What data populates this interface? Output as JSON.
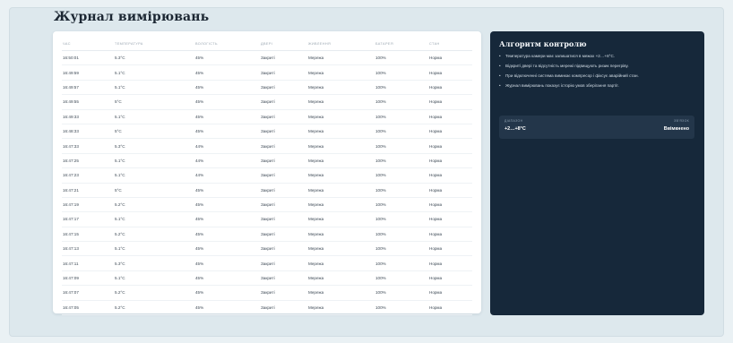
{
  "page": {
    "title": "Журнал вимірювань"
  },
  "table": {
    "columns": [
      "Час",
      "Температура",
      "Вологість",
      "Двері",
      "Живлення",
      "Батарея",
      "Стан"
    ],
    "rows": [
      [
        "16:50:01",
        "5.3°C",
        "45%",
        "Закриті",
        "Мережа",
        "100%",
        "Норма"
      ],
      [
        "16:49:59",
        "5.1°C",
        "45%",
        "Закриті",
        "Мережа",
        "100%",
        "Норма"
      ],
      [
        "16:49:57",
        "5.1°C",
        "45%",
        "Закриті",
        "Мережа",
        "100%",
        "Норма"
      ],
      [
        "16:49:55",
        "5°C",
        "45%",
        "Закриті",
        "Мережа",
        "100%",
        "Норма"
      ],
      [
        "16:49:33",
        "5.1°C",
        "45%",
        "Закриті",
        "Мережа",
        "100%",
        "Норма"
      ],
      [
        "16:48:33",
        "5°C",
        "45%",
        "Закриті",
        "Мережа",
        "100%",
        "Норма"
      ],
      [
        "16:47:33",
        "5.3°C",
        "44%",
        "Закриті",
        "Мережа",
        "100%",
        "Норма"
      ],
      [
        "16:47:25",
        "5.1°C",
        "44%",
        "Закриті",
        "Мережа",
        "100%",
        "Норма"
      ],
      [
        "16:47:23",
        "5.1°C",
        "44%",
        "Закриті",
        "Мережа",
        "100%",
        "Норма"
      ],
      [
        "16:47:21",
        "5°C",
        "45%",
        "Закриті",
        "Мережа",
        "100%",
        "Норма"
      ],
      [
        "16:47:19",
        "5.2°C",
        "45%",
        "Закриті",
        "Мережа",
        "100%",
        "Норма"
      ],
      [
        "16:47:17",
        "5.1°C",
        "45%",
        "Закриті",
        "Мережа",
        "100%",
        "Норма"
      ],
      [
        "16:47:15",
        "5.2°C",
        "45%",
        "Закриті",
        "Мережа",
        "100%",
        "Норма"
      ],
      [
        "16:47:13",
        "5.1°C",
        "45%",
        "Закриті",
        "Мережа",
        "100%",
        "Норма"
      ],
      [
        "16:47:11",
        "5.3°C",
        "45%",
        "Закриті",
        "Мережа",
        "100%",
        "Норма"
      ],
      [
        "16:47:09",
        "5.1°C",
        "45%",
        "Закриті",
        "Мережа",
        "100%",
        "Норма"
      ],
      [
        "16:47:07",
        "5.2°C",
        "45%",
        "Закриті",
        "Мережа",
        "100%",
        "Норма"
      ],
      [
        "16:47:05",
        "5.2°C",
        "45%",
        "Закриті",
        "Мережа",
        "100%",
        "Норма"
      ]
    ]
  },
  "panel": {
    "title": "Алгоритм контролю",
    "rules": [
      "Температура камери має залишатися в межах +2…+8°C.",
      "Відкриті двері та відсутність мережі підвищують ризик перегріву.",
      "При відключенні система вимикає компресор і фіксує аварійний стан.",
      "Журнал вимірювань показує історію умов зберігання партії."
    ],
    "range_label": "Діапазон",
    "range_value": "+2…+8°C",
    "status_label": "Зв'язок",
    "status_value": "Ввімкнено"
  },
  "colors": {
    "background": "#dde8ed",
    "panel": "#16283a",
    "card": "#ffffff"
  }
}
